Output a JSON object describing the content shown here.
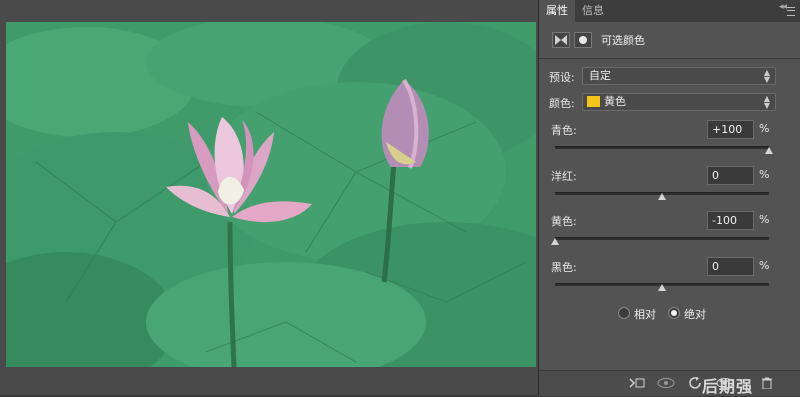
{
  "tabs": [
    {
      "label": "属性",
      "active": true
    },
    {
      "label": "信息",
      "active": false
    }
  ],
  "header": {
    "title": "可选颜色"
  },
  "preset": {
    "label": "预设:",
    "value": "自定"
  },
  "colors": {
    "label": "颜色:",
    "value": "黄色",
    "swatch": "#f5c518"
  },
  "sliders": [
    {
      "label": "青色:",
      "value": "+100",
      "unit": "%",
      "level": 1.0
    },
    {
      "label": "洋红:",
      "value": "0",
      "unit": "%",
      "level": 0.5
    },
    {
      "label": "黄色:",
      "value": "-100",
      "unit": "%",
      "level": 0.0
    },
    {
      "label": "黑色:",
      "value": "0",
      "unit": "%",
      "level": 0.5
    }
  ],
  "method": {
    "relative_label": "相对",
    "absolute_label": "绝对",
    "selected": "absolute"
  },
  "bottom_icons": [
    "clip-to-layer-icon",
    "eye-history-icon",
    "reset-icon",
    "visibility-icon",
    "trash-icon"
  ],
  "watermark": "后期强",
  "colors_palette": {
    "panel": "#535353",
    "photo_green": "#3f9b69"
  }
}
